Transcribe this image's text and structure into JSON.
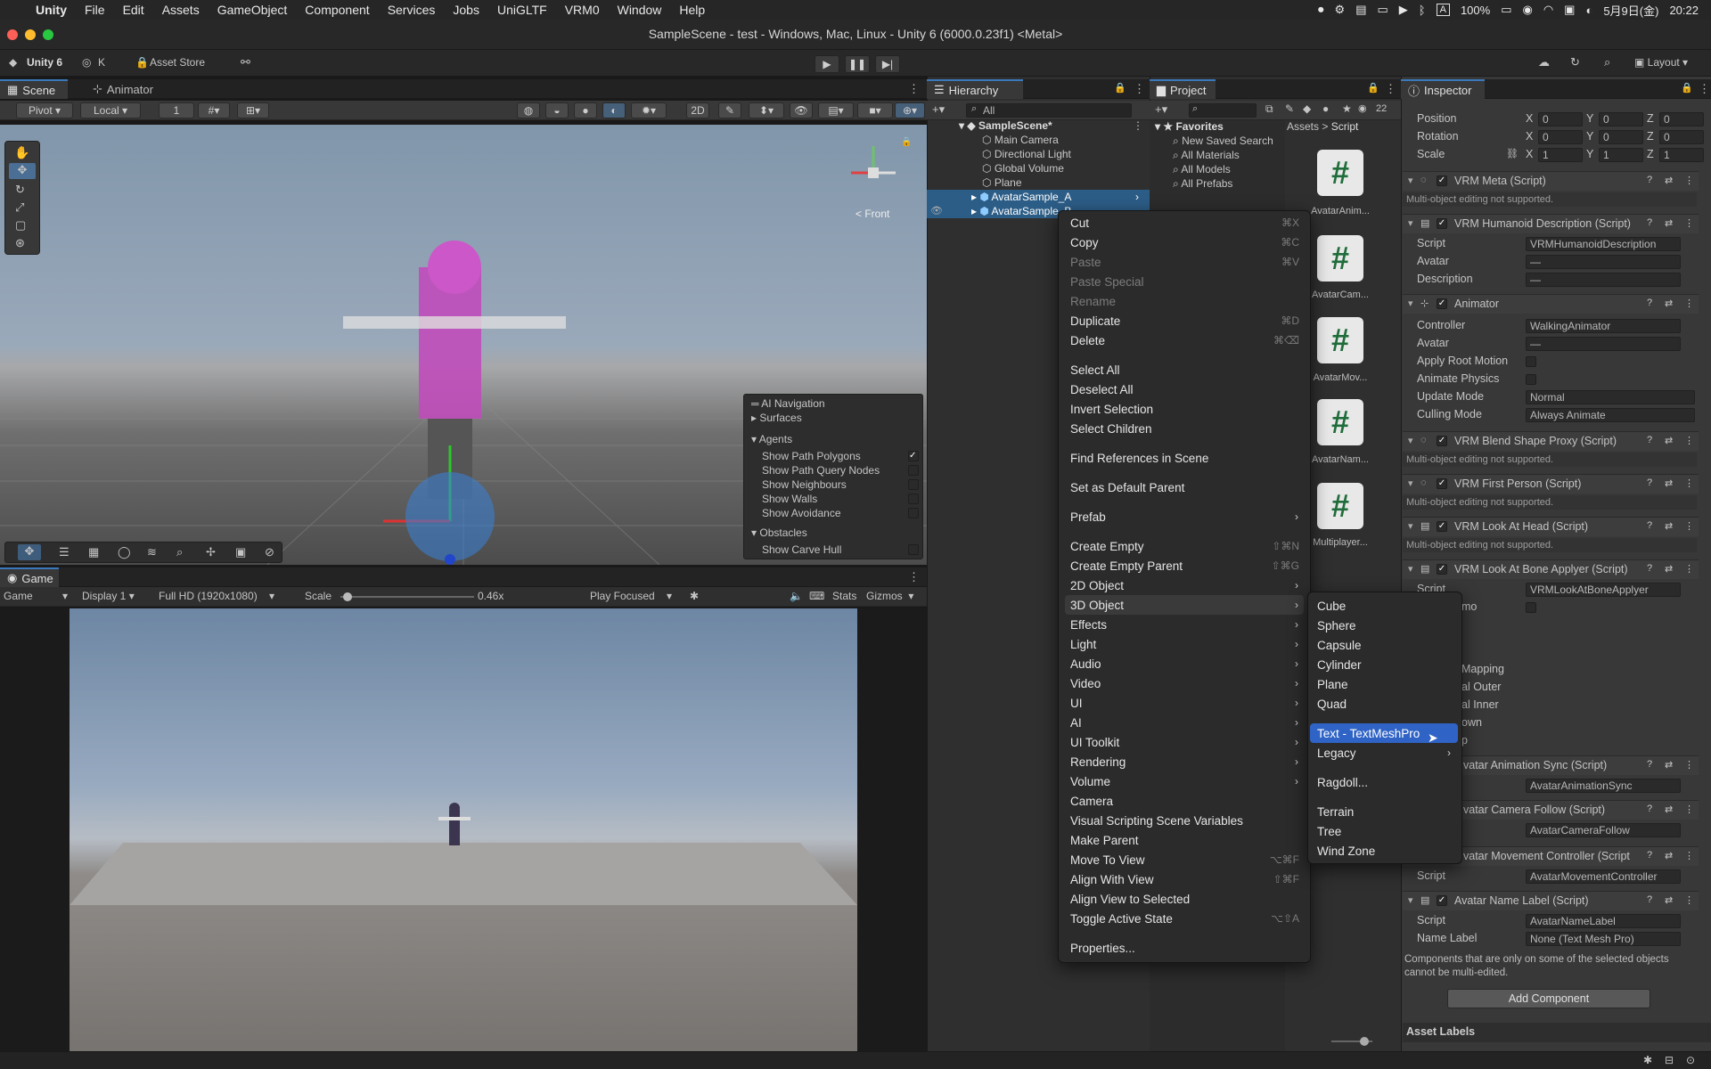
{
  "menubar": {
    "app": "Unity",
    "items": [
      "File",
      "Edit",
      "Assets",
      "GameObject",
      "Component",
      "Services",
      "Jobs",
      "UniGLTF",
      "VRM0",
      "Window",
      "Help"
    ],
    "battery": "100%",
    "ime": "A",
    "date": "5月9日(金)",
    "time": "20:22"
  },
  "window": {
    "title": "SampleScene - test - Windows, Mac, Linux - Unity 6 (6000.0.23f1) <Metal>"
  },
  "toolbar": {
    "unity_label": "Unity 6",
    "account": "K",
    "asset_store": "Asset Store",
    "layout": "Layout"
  },
  "scene_panel": {
    "tabs": [
      "Scene",
      "Animator"
    ],
    "pivot": "Pivot",
    "local": "Local",
    "grid_num": "1",
    "orient_label": "< Front",
    "ai_nav": {
      "title": "AI Navigation",
      "surfaces": "Surfaces",
      "agents": "Agents",
      "items": [
        "Show Path Polygons",
        "Show Path Query Nodes",
        "Show Neighbours",
        "Show Walls",
        "Show Avoidance"
      ],
      "checked": [
        true,
        false,
        false,
        false,
        false
      ],
      "obstacles": "Obstacles",
      "obstacle_items": [
        "Show Carve Hull"
      ]
    }
  },
  "game_panel": {
    "tab": "Game",
    "mode": "Game",
    "display": "Display 1",
    "resolution": "Full HD (1920x1080)",
    "scale_label": "Scale",
    "scale_value": "0.46x",
    "scale_fraction": 0.02,
    "play_focused": "Play Focused",
    "stats": "Stats",
    "gizmos": "Gizmos"
  },
  "hierarchy": {
    "tab": "Hierarchy",
    "search_placeholder": "All",
    "scene": "SampleScene*",
    "items": [
      "Main Camera",
      "Directional Light",
      "Global Volume",
      "Plane",
      "AvatarSample_A",
      "AvatarSample_B"
    ]
  },
  "project": {
    "tab": "Project",
    "count": "22",
    "favorites_label": "Favorites",
    "favorites": [
      "New Saved Search",
      "All Materials",
      "All Models",
      "All Prefabs"
    ],
    "breadcrumb": [
      "Assets",
      "Script"
    ],
    "assets": [
      "AvatarAnim...",
      "AvatarCam...",
      "AvatarMov...",
      "AvatarNam...",
      "Multiplayer..."
    ]
  },
  "context_menu": {
    "items": [
      {
        "label": "Cut",
        "shortcut": "⌘X"
      },
      {
        "label": "Copy",
        "shortcut": "⌘C"
      },
      {
        "label": "Paste",
        "shortcut": "⌘V",
        "disabled": true
      },
      {
        "label": "Paste Special",
        "disabled": true
      },
      {
        "label": "Rename",
        "disabled": true
      },
      {
        "label": "Duplicate",
        "shortcut": "⌘D"
      },
      {
        "label": "Delete",
        "shortcut": "⌘⌫"
      },
      {
        "label": "Select All"
      },
      {
        "label": "Deselect All"
      },
      {
        "label": "Invert Selection"
      },
      {
        "label": "Select Children"
      },
      {
        "label": "Find References in Scene"
      },
      {
        "label": "Set as Default Parent"
      },
      {
        "label": "Prefab",
        "submenu": true
      },
      {
        "label": "Create Empty",
        "shortcut": "⇧⌘N"
      },
      {
        "label": "Create Empty Parent",
        "shortcut": "⇧⌘G"
      },
      {
        "label": "2D Object",
        "submenu": true
      },
      {
        "label": "3D Object",
        "submenu": true
      },
      {
        "label": "Effects",
        "submenu": true
      },
      {
        "label": "Light",
        "submenu": true
      },
      {
        "label": "Audio",
        "submenu": true
      },
      {
        "label": "Video",
        "submenu": true
      },
      {
        "label": "UI",
        "submenu": true
      },
      {
        "label": "AI",
        "submenu": true
      },
      {
        "label": "UI Toolkit",
        "submenu": true
      },
      {
        "label": "Rendering",
        "submenu": true
      },
      {
        "label": "Volume",
        "submenu": true
      },
      {
        "label": "Camera"
      },
      {
        "label": "Visual Scripting Scene Variables"
      },
      {
        "label": "Make Parent"
      },
      {
        "label": "Move To View",
        "shortcut": "⌥⌘F"
      },
      {
        "label": "Align With View",
        "shortcut": "⇧⌘F"
      },
      {
        "label": "Align View to Selected"
      },
      {
        "label": "Toggle Active State",
        "shortcut": "⌥⇧A"
      },
      {
        "label": "Properties..."
      }
    ]
  },
  "submenu_3d": {
    "items": [
      "Cube",
      "Sphere",
      "Capsule",
      "Cylinder",
      "Plane",
      "Quad",
      "Text - TextMeshPro",
      "Legacy",
      "Ragdoll...",
      "Terrain",
      "Tree",
      "Wind Zone"
    ]
  },
  "inspector": {
    "tab": "Inspector",
    "transform": {
      "position": {
        "label": "Position",
        "x": "0",
        "y": "0",
        "z": "0"
      },
      "rotation": {
        "label": "Rotation",
        "x": "0",
        "y": "0",
        "z": "0"
      },
      "scale": {
        "label": "Scale",
        "x": "1",
        "y": "1",
        "z": "1"
      }
    },
    "axis": [
      "X",
      "Y",
      "Z"
    ],
    "multi_note": "Multi-object editing not supported.",
    "comp_vrm_meta": "VRM Meta (Script)",
    "comp_humanoid": "VRM Humanoid Description (Script)",
    "humanoid_fields": {
      "script": "Script",
      "script_val": "VRMHumanoidDescription",
      "avatar": "Avatar",
      "avatar_val": "—",
      "description": "Description",
      "description_val": "—"
    },
    "comp_animator": "Animator",
    "animator_fields": {
      "controller": "Controller",
      "controller_val": "WalkingAnimator",
      "avatar": "Avatar",
      "avatar_val": "—",
      "apply_root": "Apply Root Motion",
      "animate_physics": "Animate Physics",
      "update_mode": "Update Mode",
      "update_mode_val": "Normal",
      "culling_mode": "Culling Mode",
      "culling_mode_val": "Always Animate"
    },
    "comp_blend": "VRM Blend Shape Proxy (Script)",
    "comp_first": "VRM First Person (Script)",
    "comp_lookhead": "VRM Look At Head (Script)",
    "comp_lookbone": "VRM Look At Bone Applyer (Script)",
    "lookbone_script": "Script",
    "lookbone_script_val": "VRMLookAtBoneApplyer",
    "lookbone_partial": [
      "mo",
      "Mapping",
      "al Outer",
      "al Inner",
      "own",
      "p"
    ],
    "comp_animsync": "vatar Animation Sync (Script)",
    "animsync_script_val": "AvatarAnimationSync",
    "comp_camfollow": "vatar Camera Follow (Script)",
    "camfollow_script_val": "AvatarCameraFollow",
    "comp_movement": "vatar Movement Controller (Script",
    "movement_script": "Script",
    "movement_script_val": "AvatarMovementController",
    "comp_namelabel": "Avatar Name Label (Script)",
    "namelabel_script": "Script",
    "namelabel_script_val": "AvatarNameLabel",
    "namelabel_field": "Name Label",
    "namelabel_field_val": "None (Text Mesh Pro)",
    "bottom_note": "Components that are only on some of the selected objects cannot be multi-edited.",
    "add_component": "Add Component",
    "asset_labels": "Asset Labels"
  },
  "colors": {
    "accent": "#2f63c5",
    "selection": "#2c5d87",
    "green_icon": "#1f6d3a"
  }
}
